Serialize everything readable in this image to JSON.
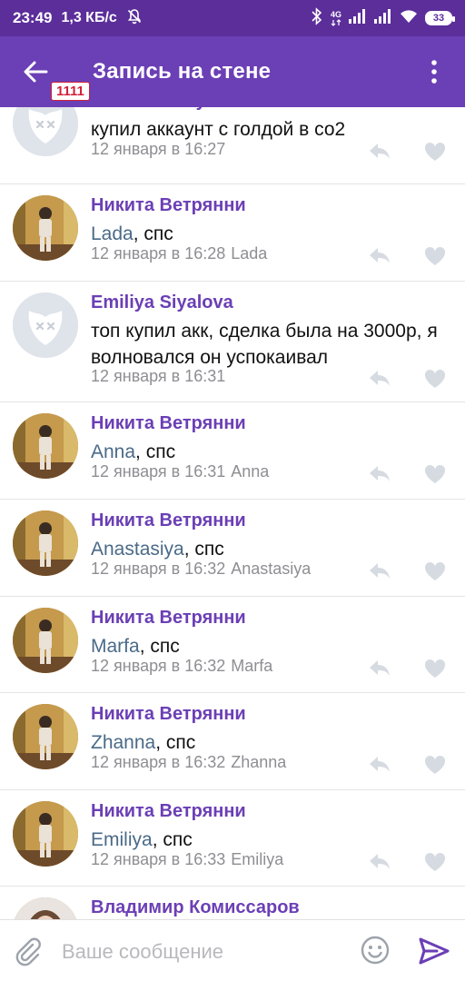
{
  "status": {
    "time": "23:49",
    "speed": "1,3 КБ/с",
    "network": "4G",
    "battery": "33"
  },
  "toolbar": {
    "title": "Запись на стене",
    "badge": "1111"
  },
  "comments": [
    {
      "author": "Zhanna Shiryaeva",
      "mention": "",
      "text": "купил аккаунт с голдой в со2",
      "date": "12 января в 16:27",
      "reply_to": "",
      "avatar": "deleted"
    },
    {
      "author": "Никита Ветрянни",
      "mention": "Lada",
      "text": ", спс",
      "date": "12 января в 16:28",
      "reply_to": "Lada",
      "avatar": "photo"
    },
    {
      "author": "Emiliya Siyalova",
      "mention": "",
      "text": "топ купил акк, сделка была на 3000р, я волновался он успокаивал",
      "date": "12 января в 16:31",
      "reply_to": "",
      "avatar": "deleted"
    },
    {
      "author": "Никита Ветрянни",
      "mention": "Anna",
      "text": ", спс",
      "date": "12 января в 16:31",
      "reply_to": "Anna",
      "avatar": "photo"
    },
    {
      "author": "Никита Ветрянни",
      "mention": "Anastasiya",
      "text": ", спс",
      "date": "12 января в 16:32",
      "reply_to": "Anastasiya",
      "avatar": "photo"
    },
    {
      "author": "Никита Ветрянни",
      "mention": "Marfa",
      "text": ", спс",
      "date": "12 января в 16:32",
      "reply_to": "Marfa",
      "avatar": "photo"
    },
    {
      "author": "Никита Ветрянни",
      "mention": "Zhanna",
      "text": ", спс",
      "date": "12 января в 16:32",
      "reply_to": "Zhanna",
      "avatar": "photo"
    },
    {
      "author": "Никита Ветрянни",
      "mention": "Emiliya",
      "text": ", спс",
      "date": "12 января в 16:33",
      "reply_to": "Emiliya",
      "avatar": "photo"
    },
    {
      "author": "Владимир Комиссаров",
      "mention": "",
      "text": "",
      "date": "",
      "reply_to": "",
      "avatar": "girl"
    }
  ],
  "composer": {
    "placeholder": "Ваше сообщение"
  },
  "icons": {
    "back": "arrow-left-icon",
    "more": "more-vertical-icon",
    "reply": "reply-icon",
    "like": "heart-icon",
    "attach": "paperclip-icon",
    "emoji": "smiley-icon",
    "send": "send-icon"
  },
  "colors": {
    "accent": "#6b3fb5",
    "statusbar": "#5b2e9a",
    "author": "#6b3fb5",
    "mention": "#4a6a88",
    "meta": "#8e8e93"
  }
}
